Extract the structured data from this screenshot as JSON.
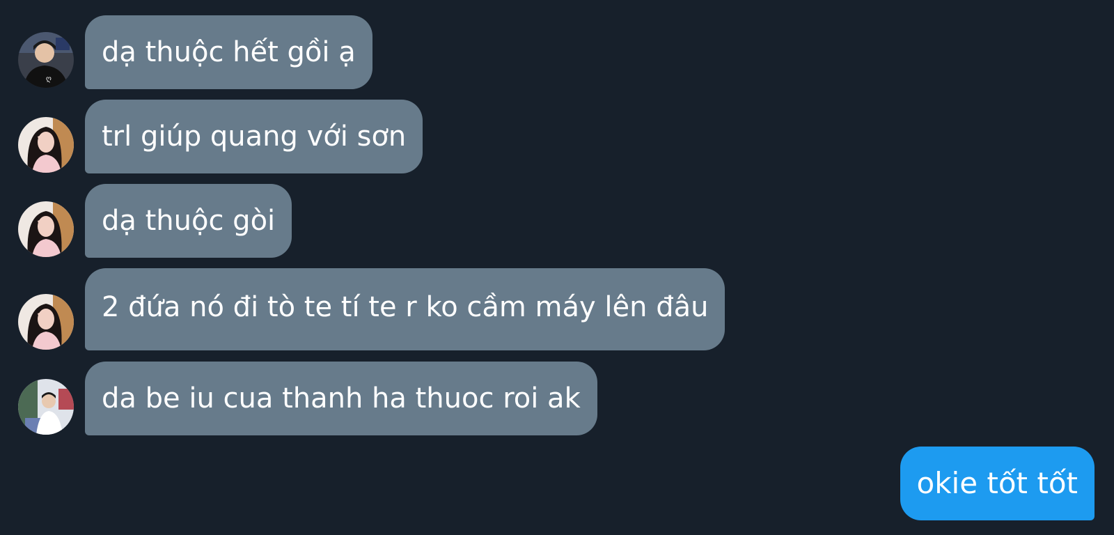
{
  "conversation": {
    "messages": [
      {
        "sender": "other",
        "avatar": "avatar-boy-black-shirt",
        "text": "dạ thuộc hết gồi ạ"
      },
      {
        "sender": "other",
        "avatar": "avatar-girl-pink",
        "text": "trl giúp quang với sơn"
      },
      {
        "sender": "other",
        "avatar": "avatar-girl-pink",
        "text": "dạ thuộc gòi"
      },
      {
        "sender": "other",
        "avatar": "avatar-girl-pink",
        "text": "2 đứa nó đi tò te tí te r ko cầm máy lên đâu"
      },
      {
        "sender": "other",
        "avatar": "avatar-boy-white-shirt",
        "text": "da be iu cua thanh ha thuoc roi ak"
      },
      {
        "sender": "me",
        "text": "okie tốt tốt"
      }
    ]
  },
  "colors": {
    "background": "#17202b",
    "incoming_bubble": "#677b8b",
    "outgoing_bubble": "#1d9bf0",
    "text": "#ffffff"
  }
}
